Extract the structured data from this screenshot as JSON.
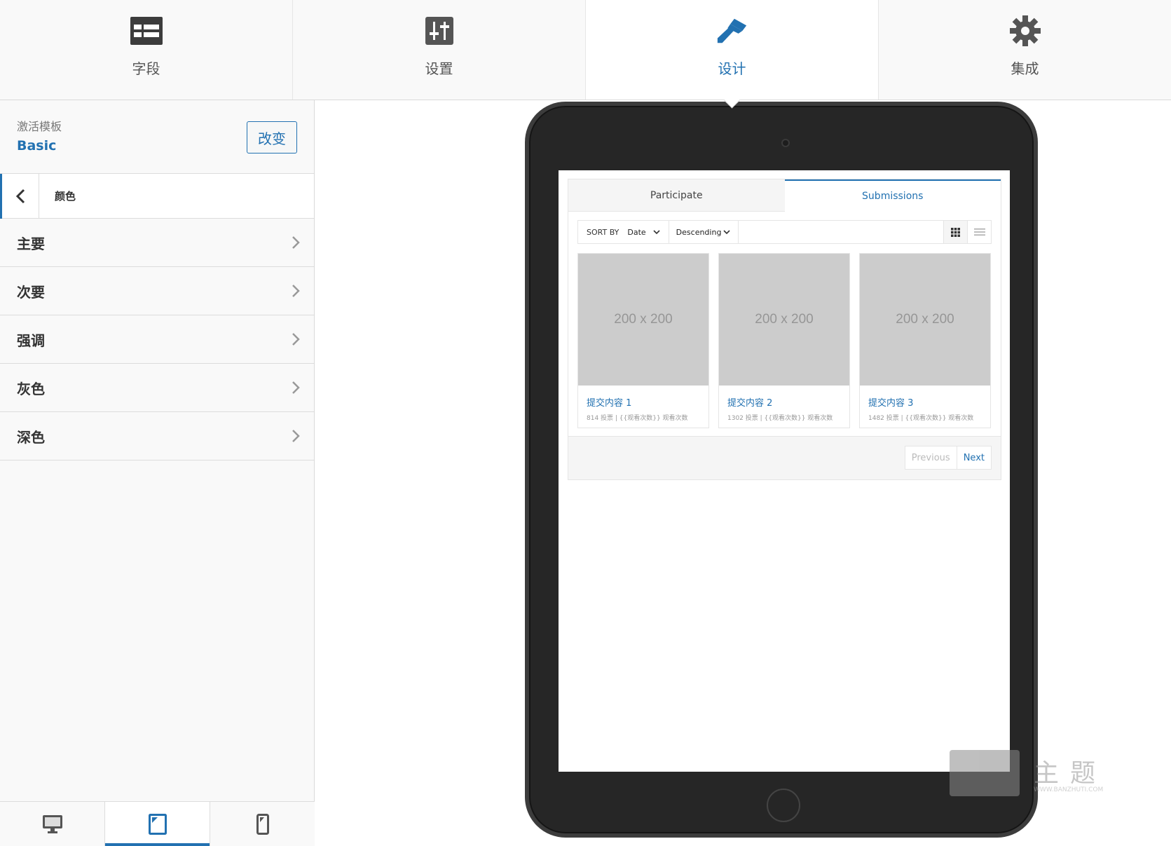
{
  "top_tabs": [
    {
      "label": "字段",
      "icon": "fields-icon"
    },
    {
      "label": "设置",
      "icon": "sliders-icon"
    },
    {
      "label": "设计",
      "icon": "paintbrush-icon"
    },
    {
      "label": "集成",
      "icon": "gear-icon"
    }
  ],
  "active_tab": "设计",
  "template": {
    "label": "激活模板",
    "name": "Basic",
    "change_label": "改变"
  },
  "section": {
    "title": "颜色"
  },
  "color_items": [
    {
      "label": "主要"
    },
    {
      "label": "次要"
    },
    {
      "label": "强调"
    },
    {
      "label": "灰色"
    },
    {
      "label": "深色"
    }
  ],
  "devices": [
    "desktop-icon",
    "tablet-icon",
    "mobile-icon"
  ],
  "active_device": "tablet-icon",
  "preview": {
    "tabs": [
      {
        "label": "Participate"
      },
      {
        "label": "Submissions"
      }
    ],
    "active_tab": "Submissions",
    "sort_by_label": "SORT BY",
    "sort_field": "Date",
    "sort_order": "Descending",
    "cards": [
      {
        "thumb": "200 x 200",
        "title": "提交内容 1",
        "meta": "814 投票 | {{观看次数}} 观看次数"
      },
      {
        "thumb": "200 x 200",
        "title": "提交内容 2",
        "meta": "1302 投票 | {{观看次数}} 观看次数"
      },
      {
        "thumb": "200 x 200",
        "title": "提交内容 3",
        "meta": "1482 投票 | {{观看次数}} 观看次数"
      }
    ],
    "pager": {
      "previous": "Previous",
      "next": "Next"
    }
  },
  "watermark": {
    "text": "主题",
    "url": "WWW.BANZHUTI.COM"
  },
  "colors": {
    "accent": "#2271b1",
    "placeholder": "#cccccc",
    "tablet_frame": "#262626"
  }
}
